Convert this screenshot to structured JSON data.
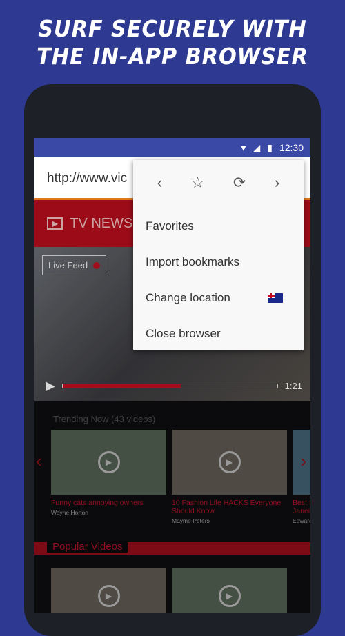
{
  "headline": {
    "line1": "SURF SECURELY WITH",
    "line2": "THE IN-APP BROWSER"
  },
  "status": {
    "time": "12:30"
  },
  "url": "http://www.vic",
  "tv": {
    "title": "TV NEWS"
  },
  "hero": {
    "live_label": "Live Feed",
    "time": "1:21",
    "progress": 0.55
  },
  "trending": {
    "title": "Trending Now (43 videos)",
    "cards": [
      {
        "title": "Funny cats annoying owners",
        "author": "Wayne Horton"
      },
      {
        "title": "10 Fashion Life HACKS Everyone Should Know",
        "author": "Mayme Peters"
      },
      {
        "title": "Best I Janei",
        "author": "Edward"
      }
    ]
  },
  "popular": {
    "title": "Popular Videos"
  },
  "menu": {
    "items": [
      {
        "label": "Favorites"
      },
      {
        "label": "Import bookmarks"
      },
      {
        "label": "Change location"
      },
      {
        "label": "Close browser"
      }
    ]
  },
  "colors": {
    "accent": "#b80d1c",
    "background": "#2e3a92"
  }
}
